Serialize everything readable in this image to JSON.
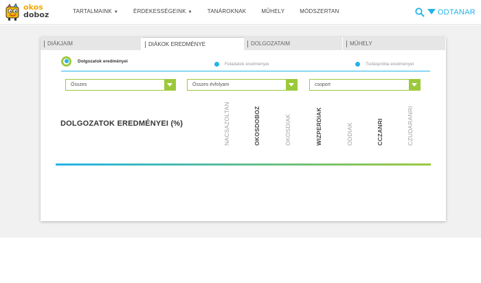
{
  "brand": {
    "logo_line1": "okos",
    "logo_line2": "doboz",
    "right_label": "ODTANAR"
  },
  "nav": [
    {
      "label": "TARTALMAINK",
      "has_caret": true
    },
    {
      "label": "ÉRDEKESSÉGEINK",
      "has_caret": true
    },
    {
      "label": "TANÁROKNAK",
      "has_caret": false
    },
    {
      "label": "MŰHELY",
      "has_caret": false
    },
    {
      "label": "MÓDSZERTAN",
      "has_caret": false
    }
  ],
  "tabs": [
    {
      "label": "DIÁKJAIM",
      "active": false
    },
    {
      "label": "DIÁKOK EREDMÉNYE",
      "active": true
    },
    {
      "label": "DOLGOZATAIM",
      "active": false
    },
    {
      "label": "MŰHELY",
      "active": false
    }
  ],
  "radios": [
    {
      "label": "Dolgozatok eredményei",
      "selected": true
    },
    {
      "label": "Feladatok eredményei",
      "selected": false
    },
    {
      "label": "Tudáspróba eredményei",
      "selected": false
    }
  ],
  "selects": [
    {
      "value": "Összes"
    },
    {
      "value": "Összes évfolyam"
    },
    {
      "value": "csoport"
    }
  ],
  "results": {
    "title": "DOLGOZATOK EREDMÉNYEI (%)",
    "columns": [
      {
        "label": "NACSAZOLTAN",
        "emphasis": "light"
      },
      {
        "label": "OKOSDOBOZ",
        "emphasis": "dark"
      },
      {
        "label": "OKOSDIAK",
        "emphasis": "light"
      },
      {
        "label": "WIZPERDIAK",
        "emphasis": "dark"
      },
      {
        "label": "ODDIAK",
        "emphasis": "light"
      },
      {
        "label": "CCZANRI",
        "emphasis": "dark"
      },
      {
        "label": "CZUDARANRI",
        "emphasis": "light"
      }
    ]
  },
  "colors": {
    "accent_blue": "#22b4e8",
    "accent_green": "#9cc93b",
    "logo_orange": "#f5a700"
  },
  "icons": {
    "search": "search-icon",
    "heart": "heart-icon",
    "select_arrow": "chevron-down-icon",
    "mascot": "mascot-icon"
  }
}
